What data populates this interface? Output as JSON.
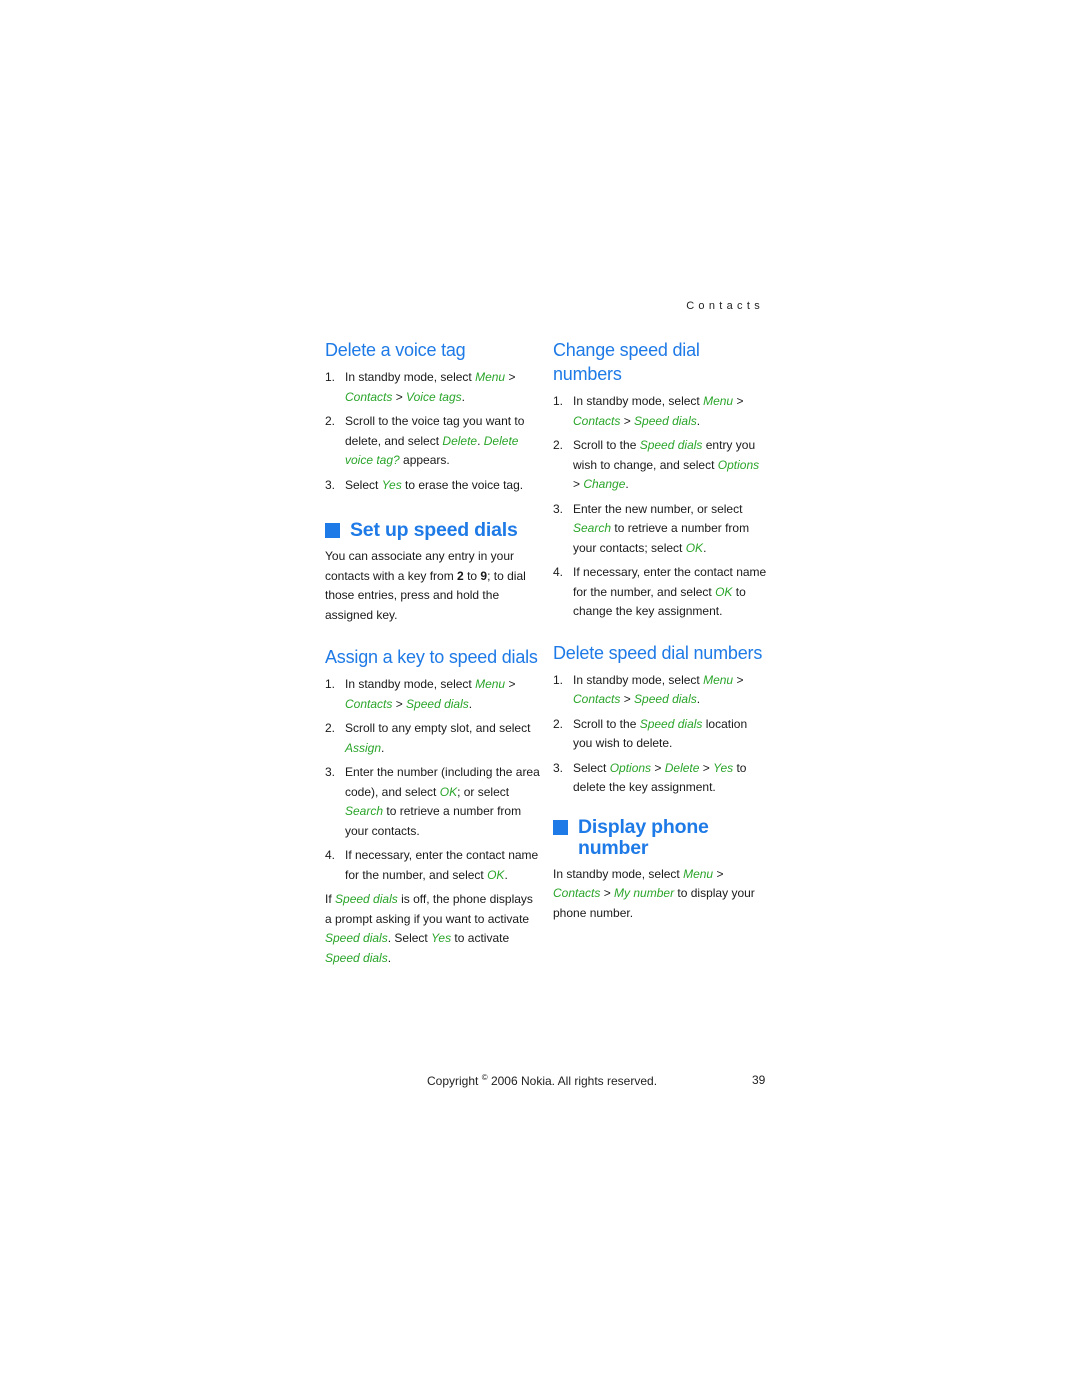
{
  "running_head": "Contacts",
  "left": {
    "delete_voice_tag": {
      "title": "Delete a voice tag",
      "steps": [
        {
          "n": "1.",
          "parts": [
            [
              "t",
              "In standby mode, select "
            ],
            [
              "g",
              "Menu"
            ],
            [
              "t",
              " > "
            ],
            [
              "g",
              "Contacts"
            ],
            [
              "t",
              " > "
            ],
            [
              "g",
              "Voice tags"
            ],
            [
              "t",
              "."
            ]
          ]
        },
        {
          "n": "2.",
          "parts": [
            [
              "t",
              "Scroll to the voice tag you want to delete, and select "
            ],
            [
              "g",
              "Delete"
            ],
            [
              "t",
              ". "
            ],
            [
              "g",
              "Delete voice tag?"
            ],
            [
              "t",
              " appears."
            ]
          ]
        },
        {
          "n": "3.",
          "parts": [
            [
              "t",
              "Select "
            ],
            [
              "g",
              "Yes"
            ],
            [
              "t",
              " to erase the voice tag."
            ]
          ]
        }
      ]
    },
    "set_up_speed_dials": {
      "title": "Set up speed dials",
      "intro": [
        [
          "t",
          "You can associate any entry in your contacts with a key from "
        ],
        [
          "b",
          "2"
        ],
        [
          "t",
          " to "
        ],
        [
          "b",
          "9"
        ],
        [
          "t",
          "; to dial those entries, press and hold the assigned key."
        ]
      ]
    },
    "assign_key": {
      "title": "Assign a key to speed dials",
      "steps": [
        {
          "n": "1.",
          "parts": [
            [
              "t",
              "In standby mode, select "
            ],
            [
              "g",
              "Menu"
            ],
            [
              "t",
              " > "
            ],
            [
              "g",
              "Contacts"
            ],
            [
              "t",
              " > "
            ],
            [
              "g",
              "Speed dials"
            ],
            [
              "t",
              "."
            ]
          ]
        },
        {
          "n": "2.",
          "parts": [
            [
              "t",
              "Scroll to any empty slot, and select "
            ],
            [
              "g",
              "Assign"
            ],
            [
              "t",
              "."
            ]
          ]
        },
        {
          "n": "3.",
          "parts": [
            [
              "t",
              "Enter the number (including the area code), and select "
            ],
            [
              "g",
              "OK"
            ],
            [
              "t",
              "; or select "
            ],
            [
              "g",
              "Search"
            ],
            [
              "t",
              " to retrieve a number from your contacts."
            ]
          ]
        },
        {
          "n": "4.",
          "parts": [
            [
              "t",
              "If necessary, enter the contact name for the number, and select "
            ],
            [
              "g",
              "OK"
            ],
            [
              "t",
              "."
            ]
          ]
        }
      ],
      "note": [
        [
          "t",
          "If "
        ],
        [
          "g",
          "Speed dials"
        ],
        [
          "t",
          " is off, the phone displays a prompt asking if you want to activate "
        ],
        [
          "g",
          "Speed dials"
        ],
        [
          "t",
          ". Select "
        ],
        [
          "g",
          "Yes"
        ],
        [
          "t",
          " to activate "
        ],
        [
          "g",
          "Speed dials"
        ],
        [
          "t",
          "."
        ]
      ]
    }
  },
  "right": {
    "change_speed_dial": {
      "title": "Change speed dial numbers",
      "steps": [
        {
          "n": "1.",
          "parts": [
            [
              "t",
              "In standby mode, select "
            ],
            [
              "g",
              "Menu"
            ],
            [
              "t",
              " > "
            ],
            [
              "g",
              "Contacts"
            ],
            [
              "t",
              " > "
            ],
            [
              "g",
              "Speed dials"
            ],
            [
              "t",
              "."
            ]
          ]
        },
        {
          "n": "2.",
          "parts": [
            [
              "t",
              "Scroll to the "
            ],
            [
              "g",
              "Speed dials"
            ],
            [
              "t",
              " entry you wish to change, and select "
            ],
            [
              "g",
              "Options"
            ],
            [
              "t",
              " > "
            ],
            [
              "g",
              "Change"
            ],
            [
              "t",
              "."
            ]
          ]
        },
        {
          "n": "3.",
          "parts": [
            [
              "t",
              "Enter the new number, or select "
            ],
            [
              "g",
              "Search"
            ],
            [
              "t",
              " to retrieve a number from your contacts; select "
            ],
            [
              "g",
              "OK"
            ],
            [
              "t",
              "."
            ]
          ]
        },
        {
          "n": "4.",
          "parts": [
            [
              "t",
              "If necessary, enter the contact name for the number, and select "
            ],
            [
              "g",
              "OK"
            ],
            [
              "t",
              " to change the key assignment."
            ]
          ]
        }
      ]
    },
    "delete_speed_dial": {
      "title": "Delete speed dial numbers",
      "steps": [
        {
          "n": "1.",
          "parts": [
            [
              "t",
              "In standby mode, select "
            ],
            [
              "g",
              "Menu"
            ],
            [
              "t",
              " > "
            ],
            [
              "g",
              "Contacts"
            ],
            [
              "t",
              " > "
            ],
            [
              "g",
              "Speed dials"
            ],
            [
              "t",
              "."
            ]
          ]
        },
        {
          "n": "2.",
          "parts": [
            [
              "t",
              "Scroll to the "
            ],
            [
              "g",
              "Speed dials"
            ],
            [
              "t",
              " location you wish to delete."
            ]
          ]
        },
        {
          "n": "3.",
          "parts": [
            [
              "t",
              "Select "
            ],
            [
              "g",
              "Options"
            ],
            [
              "t",
              " > "
            ],
            [
              "g",
              "Delete"
            ],
            [
              "t",
              " > "
            ],
            [
              "g",
              "Yes"
            ],
            [
              "t",
              " to delete the key assignment."
            ]
          ]
        }
      ]
    },
    "display_phone_number": {
      "title_line1": "Display phone",
      "title_line2": "number",
      "body": [
        [
          "t",
          "In standby mode, select "
        ],
        [
          "g",
          "Menu"
        ],
        [
          "t",
          " > "
        ],
        [
          "g",
          "Contacts"
        ],
        [
          "t",
          " > "
        ],
        [
          "g",
          "My number"
        ],
        [
          "t",
          " to display your phone number."
        ]
      ]
    }
  },
  "footer": {
    "copyright_pre": "Copyright ",
    "copyright_symbol": "©",
    "copyright_post": " 2006 Nokia. All rights reserved.",
    "page_number": "39"
  },
  "colors": {
    "heading_blue": "#1e7ae6",
    "ui_term_green": "#2aa52a"
  }
}
